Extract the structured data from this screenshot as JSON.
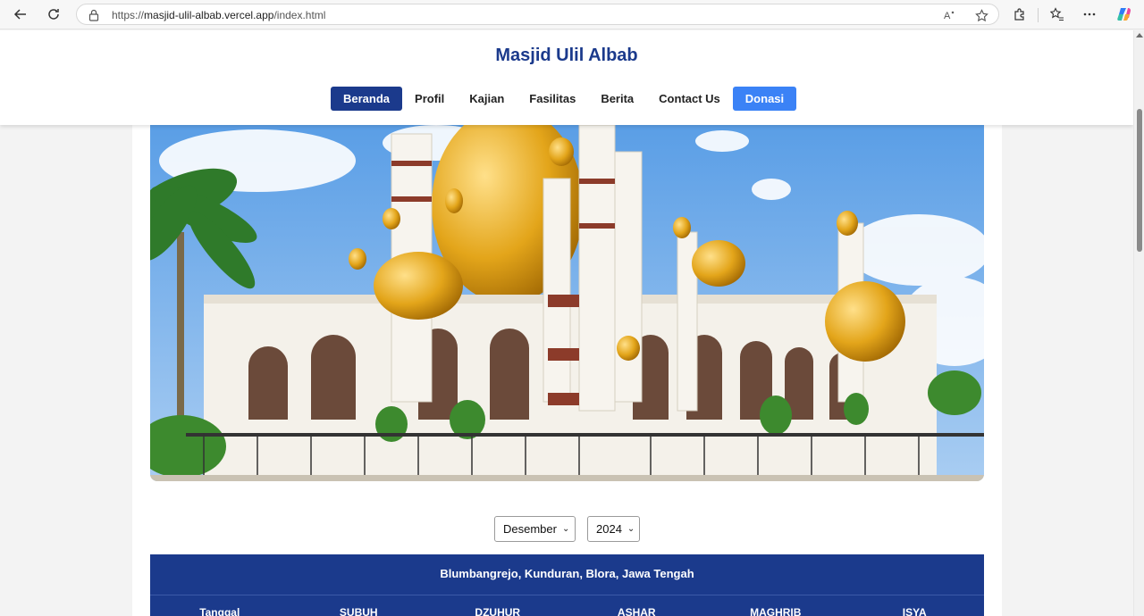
{
  "browser": {
    "url_prefix": "https://",
    "url_host": "masjid-ulil-albab.vercel.app",
    "url_path": "/index.html"
  },
  "site": {
    "title": "Masjid Ulil Albab"
  },
  "nav": {
    "items": [
      {
        "label": "Beranda",
        "state": "active"
      },
      {
        "label": "Profil"
      },
      {
        "label": "Kajian"
      },
      {
        "label": "Fasilitas"
      },
      {
        "label": "Berita"
      },
      {
        "label": "Contact Us"
      },
      {
        "label": "Donasi",
        "state": "highlight"
      }
    ]
  },
  "filters": {
    "month": "Desember",
    "year": "2024"
  },
  "schedule": {
    "location": "Blumbangrejo, Kunduran, Blora, Jawa Tengah",
    "columns": [
      "Tanggal",
      "SUBUH",
      "DZUHUR",
      "ASHAR",
      "MAGHRIB",
      "ISYA"
    ]
  },
  "colors": {
    "primary": "#1b3a8c",
    "accent": "#3b82f6"
  }
}
